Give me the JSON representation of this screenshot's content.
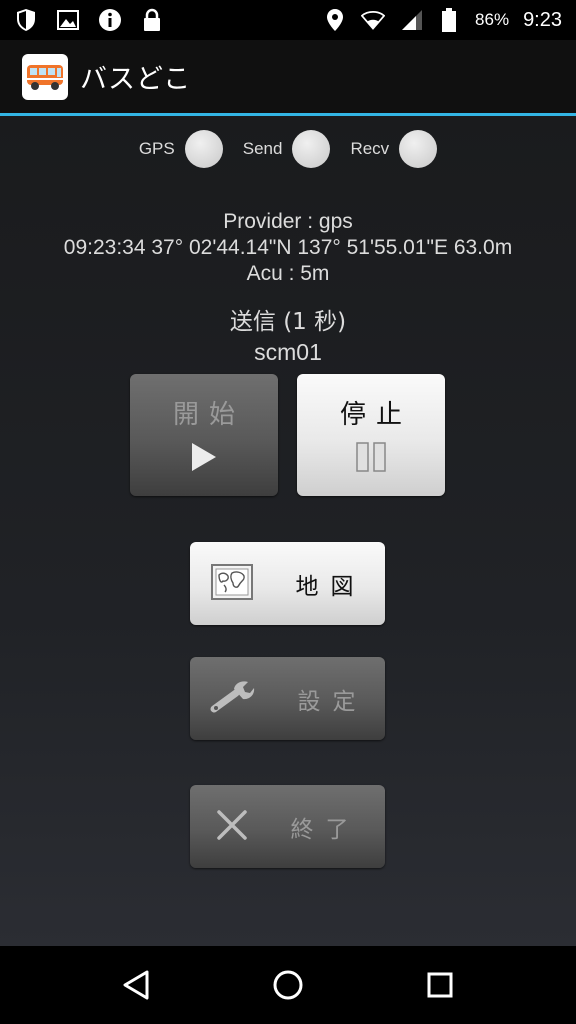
{
  "status_bar": {
    "icons_left": [
      "shield-icon",
      "image-icon",
      "info-icon",
      "lock-icon"
    ],
    "icons_right": [
      "location-icon",
      "wifi-icon",
      "signal-icon",
      "battery-icon"
    ],
    "battery": "86%",
    "time": "9:23"
  },
  "action_bar": {
    "app_icon": "bus-icon",
    "title": "バスどこ"
  },
  "indicators": [
    {
      "label": "GPS"
    },
    {
      "label": "Send"
    },
    {
      "label": "Recv"
    }
  ],
  "info": {
    "provider": "Provider : gps",
    "location": "09:23:34  37° 02'44.14\"N 137° 51'55.01\"E   63.0m",
    "accuracy": "Acu : 5m",
    "send_interval": "送信 (1 秒)",
    "user": "scm01"
  },
  "buttons": {
    "start": {
      "label": "開始",
      "icon": "play-icon"
    },
    "stop": {
      "label": "停止",
      "icon": "pause-icon"
    },
    "map": {
      "label": "地図",
      "icon": "map-icon"
    },
    "settings": {
      "label": "設定",
      "icon": "wrench-icon"
    },
    "exit": {
      "label": "終了",
      "icon": "close-icon"
    }
  },
  "nav_bar": {
    "icons": [
      "back-icon",
      "home-icon",
      "recents-icon"
    ]
  },
  "colors": {
    "accent": "#33b5e5",
    "bus": "#f0742a"
  }
}
